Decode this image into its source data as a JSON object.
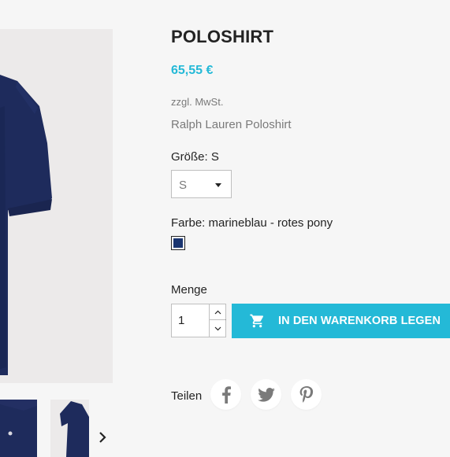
{
  "product": {
    "title": "POLOSHIRT",
    "price": "65,55 €",
    "tax_note": "zzgl. MwSt.",
    "short_description": "Ralph Lauren Poloshirt"
  },
  "variants": {
    "size_label": "Größe: S",
    "size_selected": "S",
    "color_label": "Farbe: marineblau - rotes pony",
    "color_swatch": "#1a3570"
  },
  "purchase": {
    "quantity_label": "Menge",
    "quantity_value": "1",
    "add_to_cart_label": "IN DEN WARENKORB LEGEN"
  },
  "share": {
    "label": "Teilen",
    "networks": [
      "facebook-icon",
      "twitter-icon",
      "pinterest-icon"
    ]
  },
  "colors": {
    "accent": "#24b9d7",
    "shirt_navy": "#1e2b5c",
    "text_muted": "#7a7a7a"
  }
}
